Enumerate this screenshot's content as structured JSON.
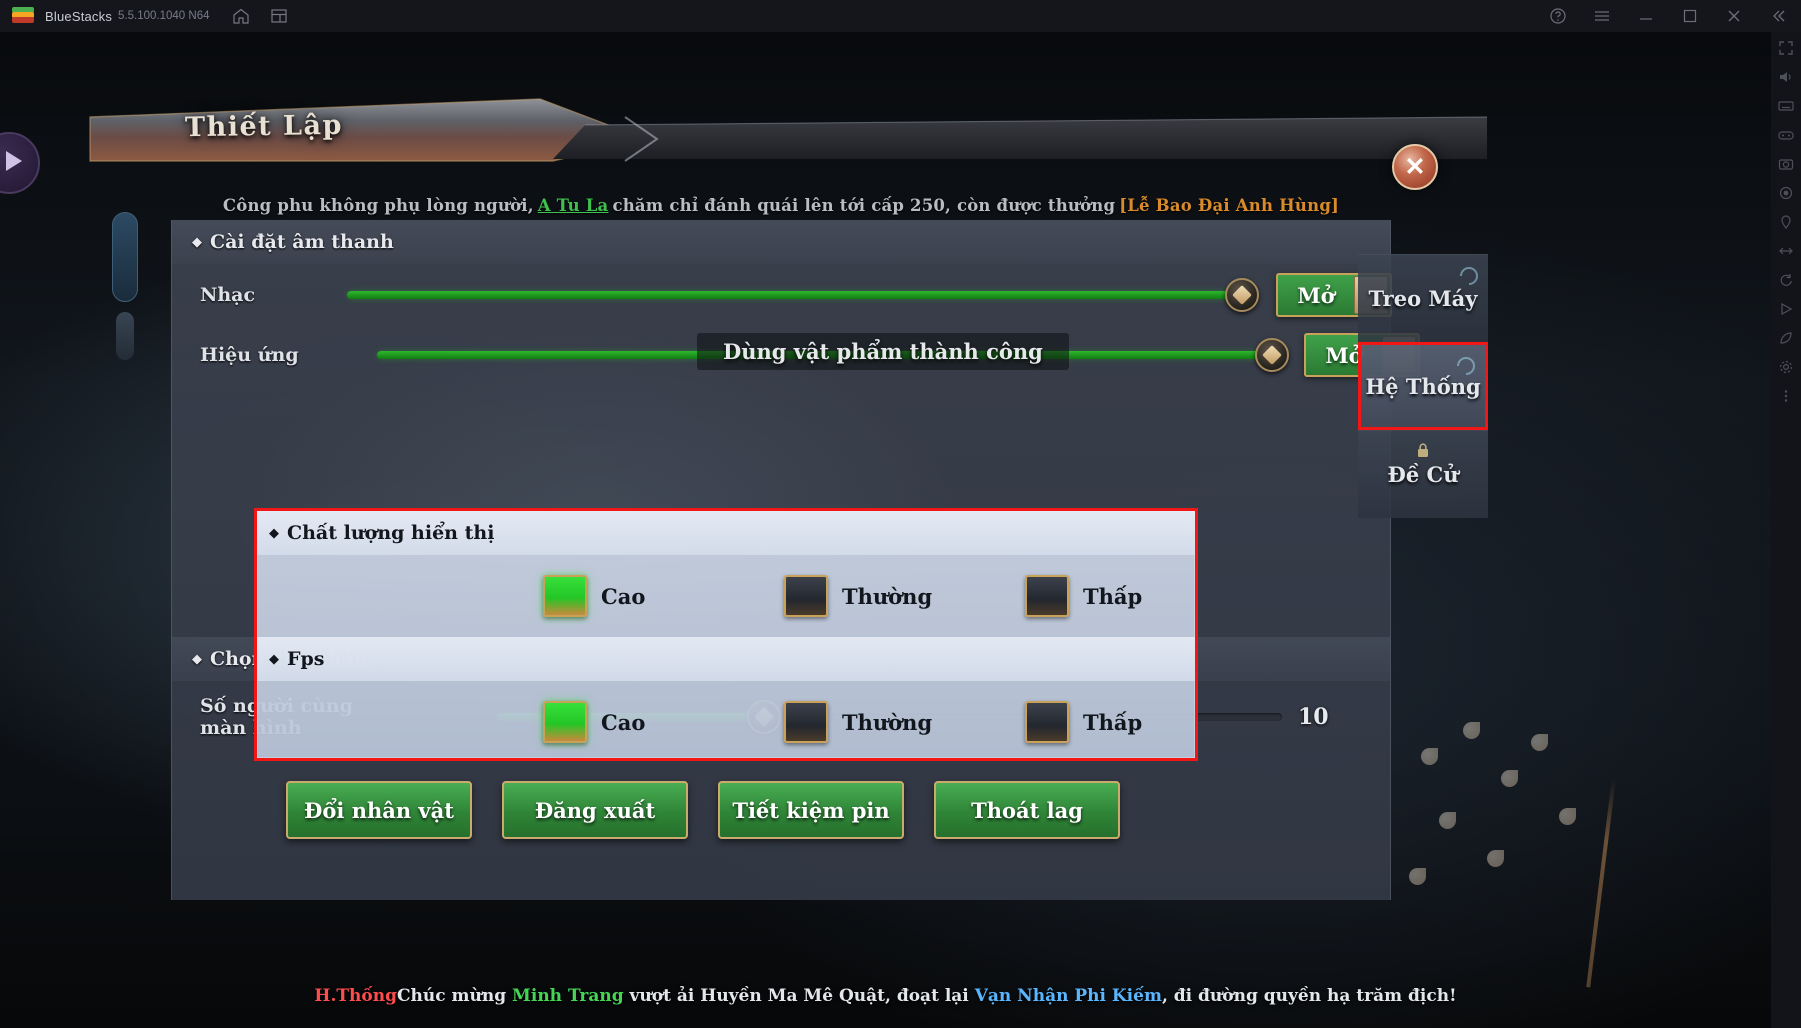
{
  "titlebar": {
    "app_name": "BlueStacks",
    "version": "5.5.100.1040 N64",
    "left_icons": [
      "home-icon",
      "multi-instance-icon"
    ],
    "right_icons": [
      "help-icon",
      "menu-icon",
      "minimize-icon",
      "maximize-icon",
      "close-icon",
      "collapse-icon"
    ]
  },
  "rail_right": {
    "icons": [
      "fullscreen-icon",
      "volume-icon",
      "keyboard-icon",
      "gamepad-icon",
      "screenshot-icon",
      "record-icon",
      "location-icon",
      "shake-icon",
      "rotate-icon",
      "macro-icon",
      "eco-icon",
      "settings-icon",
      "more-icon"
    ]
  },
  "window": {
    "title": "Thiết Lập",
    "close_label": "✕"
  },
  "marquee": {
    "part1": "Công phu không phụ lòng người,",
    "highlight_green": "A Tu La",
    "part2": "chăm chỉ đánh quái lên tới cấp 250, còn được thưởng",
    "highlight_gold": "[Lễ Bao Đại Anh Hùng]"
  },
  "toast": {
    "message": "Dùng vật phẩm thành công"
  },
  "sections": {
    "audio": {
      "header": "Cài đặt âm thanh",
      "diamond": "◆",
      "rows": [
        {
          "label": "Nhạc",
          "value": 100,
          "toggle_label": "Mở"
        },
        {
          "label": "Hiệu ứng",
          "value": 100,
          "toggle_label": "Mở"
        }
      ]
    },
    "display_quality": {
      "header": "Chất lượng hiển thị",
      "diamond": "◆",
      "options": [
        {
          "label": "Cao",
          "selected": true
        },
        {
          "label": "Thường",
          "selected": false
        },
        {
          "label": "Thấp",
          "selected": false
        }
      ]
    },
    "fps": {
      "header": "Fps",
      "diamond": "◆",
      "options": [
        {
          "label": "Cao",
          "selected": true
        },
        {
          "label": "Thường",
          "selected": false
        },
        {
          "label": "Thấp",
          "selected": false
        }
      ]
    },
    "shield": {
      "header": "Chọn che chắn",
      "diamond": "◆",
      "row": {
        "label": "Số người cùng màn hình",
        "value": "10",
        "percent": 34
      }
    }
  },
  "buttons": [
    {
      "label": "Đổi nhân vật"
    },
    {
      "label": "Đăng xuất"
    },
    {
      "label": "Tiết kiệm pin"
    },
    {
      "label": "Thoát lag"
    }
  ],
  "tabs": [
    {
      "label": "Treo Máy",
      "active": false,
      "locked": false
    },
    {
      "label": "Hệ Thống",
      "active": true,
      "locked": false
    },
    {
      "label": "Đề Cử",
      "active": false,
      "locked": true
    }
  ],
  "chat": {
    "channel": "H.Thống",
    "text1": "Chúc mừng",
    "player": "Minh Trang",
    "text2": "vượt ải Huyền Ma Mê Quật, đoạt lại",
    "item": "Vạn Nhận Phi Kiếm",
    "text3": ", đi đường quyền hạ trăm địch!"
  },
  "colors": {
    "accent_red": "#f31616",
    "green": "#2eb82e",
    "gold": "#c9a259",
    "marquee_gold": "#d98b2b"
  }
}
